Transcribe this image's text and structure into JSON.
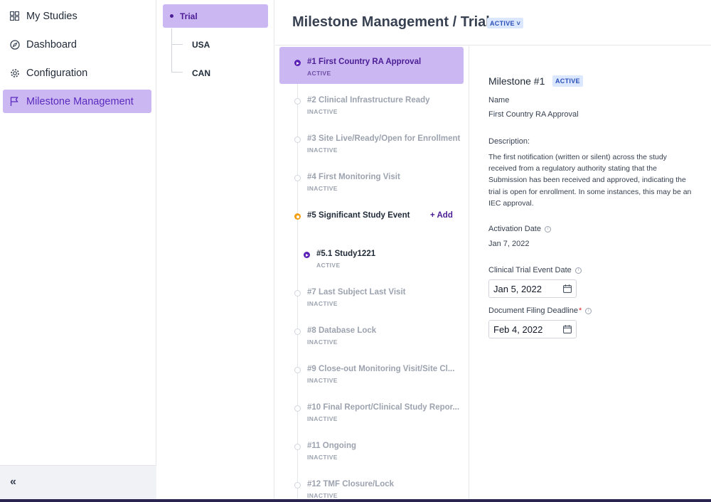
{
  "nav": {
    "items": [
      {
        "label": "My Studies",
        "icon": "grid-icon"
      },
      {
        "label": "Dashboard",
        "icon": "compass-icon"
      },
      {
        "label": "Configuration",
        "icon": "gear-icon"
      },
      {
        "label": "Milestone Management",
        "icon": "flag-icon",
        "active": true
      }
    ],
    "collapse_label": "«"
  },
  "tree": {
    "root": "Trial",
    "children": [
      "USA",
      "CAN"
    ]
  },
  "header": {
    "title": "Milestone Management / Trial",
    "status": "ACTIVE ˅"
  },
  "milestones": [
    {
      "title": "#1 First Country RA Approval",
      "status": "ACTIVE"
    },
    {
      "title": "#2 Clinical Infrastructure Ready",
      "status": "INACTIVE"
    },
    {
      "title": "#3 Site Live/Ready/Open for Enrollment",
      "status": "INACTIVE"
    },
    {
      "title": "#4 First Monitoring Visit",
      "status": "INACTIVE"
    },
    {
      "title": "#5 Significant Study Event",
      "status": "",
      "add_label": "+ Add"
    },
    {
      "title": "#5.1 Study1221",
      "status": "ACTIVE"
    },
    {
      "title": "#7 Last Subject Last Visit",
      "status": "INACTIVE"
    },
    {
      "title": "#8 Database Lock",
      "status": "INACTIVE"
    },
    {
      "title": "#9 Close-out Monitoring Visit/Site Cl...",
      "status": "INACTIVE"
    },
    {
      "title": "#10 Final Report/Clinical Study Repor...",
      "status": "INACTIVE"
    },
    {
      "title": "#11 Ongoing",
      "status": "INACTIVE"
    },
    {
      "title": "#12 TMF Closure/Lock",
      "status": "INACTIVE"
    }
  ],
  "detail": {
    "title": "Milestone #1",
    "badge": "ACTIVE",
    "name_label": "Name",
    "name_value": "First Country RA Approval",
    "desc_label": "Description:",
    "desc_value": "The first notification (written or silent) across the study received from a regulatory authority stating that the Submission has been received and approved, indicating the trial is open for enrollment. In some instances, this may be an IEC approval.",
    "activation_label": "Activation Date",
    "activation_value": "Jan 7, 2022",
    "event_date_label": "Clinical Trial Event Date",
    "event_date_value": "Jan 5, 2022",
    "filing_label": "Document Filing Deadline",
    "filing_required": "*",
    "filing_value": "Feb 4, 2022"
  },
  "colors": {
    "accent": "#5b2bbf",
    "active_bg": "#cbb8f3",
    "badge_bg": "#dbe6ff",
    "annotation_arrow": "#b3261e"
  }
}
